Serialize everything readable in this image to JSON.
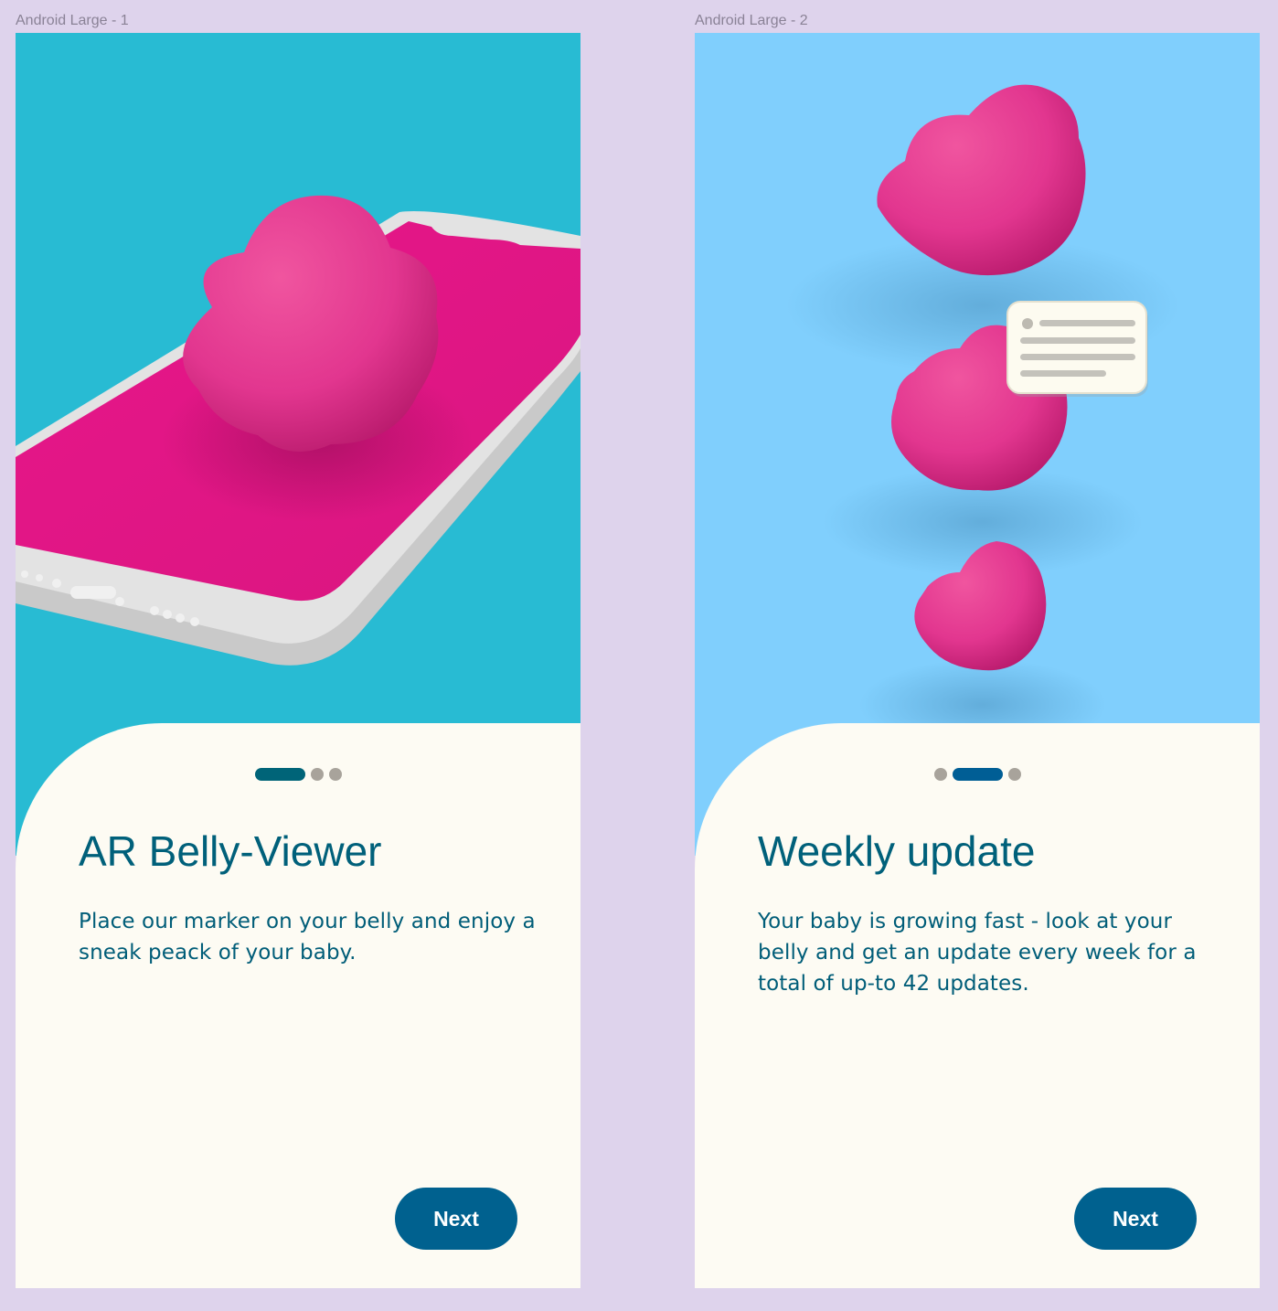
{
  "screens": [
    {
      "frame_label": "Android Large - 1",
      "title": "AR Belly-Viewer",
      "description": "Place our marker on your belly and enjoy a sneak peack of your baby.",
      "next_label": "Next",
      "hero_background": "#28bbd3",
      "illustration": "phone-with-pink-blob",
      "pager": {
        "total": 3,
        "active_index": 0
      }
    },
    {
      "frame_label": "Android Large - 2",
      "title": "Weekly update",
      "description": "Your baby is growing fast - look at your belly and get an update every week for a total of up-to 42 updates.",
      "next_label": "Next",
      "hero_background": "#80cffd",
      "illustration": "three-pink-blobs-with-notification",
      "pager": {
        "total": 3,
        "active_index": 1
      }
    }
  ],
  "colors": {
    "canvas": "#ded3ec",
    "card": "#fdfbf3",
    "title_text": "#00607a",
    "body_text": "#005d78",
    "button": "#00618f",
    "blob_pink": "#e2368f",
    "dot_inactive": "#a8a39b"
  }
}
